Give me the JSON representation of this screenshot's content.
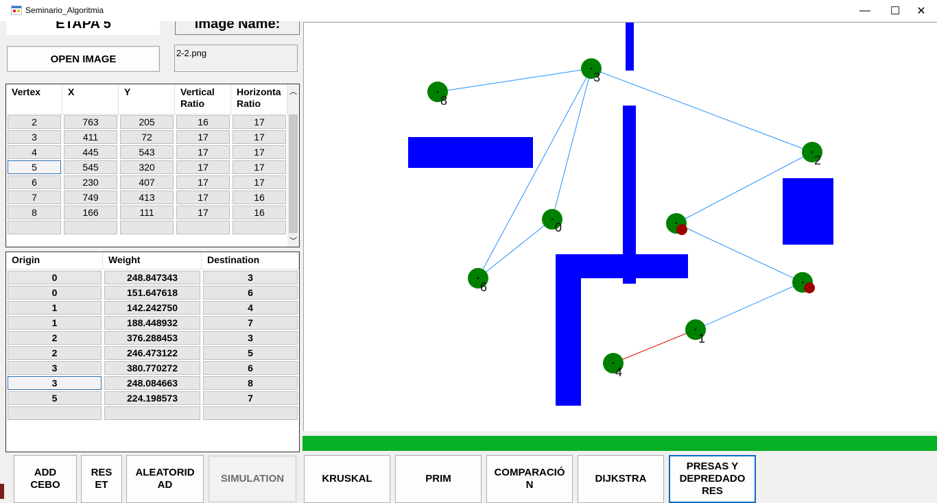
{
  "window": {
    "title": "Seminario_Algoritmia",
    "minimize": "—",
    "maximize": "☐",
    "close": "✕"
  },
  "header": {
    "stage": "ETAPA 5",
    "image_name_label": "Image Name:",
    "open_button": "OPEN IMAGE",
    "file_name": "2-2.png"
  },
  "vertex_table": {
    "columns": [
      "Vertex",
      "X",
      "Y",
      "Vertical\nRatio",
      "Horizonta\nRatio"
    ],
    "rows": [
      [
        "2",
        "763",
        "205",
        "16",
        "17"
      ],
      [
        "3",
        "411",
        "72",
        "17",
        "17"
      ],
      [
        "4",
        "445",
        "543",
        "17",
        "17"
      ],
      [
        "5",
        "545",
        "320",
        "17",
        "17"
      ],
      [
        "6",
        "230",
        "407",
        "17",
        "17"
      ],
      [
        "7",
        "749",
        "413",
        "17",
        "16"
      ],
      [
        "8",
        "166",
        "111",
        "17",
        "16"
      ],
      [
        "",
        "",
        "",
        "",
        ""
      ]
    ]
  },
  "edge_table": {
    "columns": [
      "Origin",
      "Weight",
      "Destination"
    ],
    "rows": [
      [
        "0",
        "248.847343",
        "3"
      ],
      [
        "0",
        "151.647618",
        "6"
      ],
      [
        "1",
        "142.242750",
        "4"
      ],
      [
        "1",
        "188.448932",
        "7"
      ],
      [
        "2",
        "376.288453",
        "3"
      ],
      [
        "2",
        "246.473122",
        "5"
      ],
      [
        "3",
        "380.770272",
        "6"
      ],
      [
        "3",
        "248.084663",
        "8"
      ],
      [
        "5",
        "224.198573",
        "7"
      ],
      [
        "",
        "",
        ""
      ]
    ]
  },
  "graph": {
    "node_color": "#008000",
    "predator_color": "#9b0000",
    "obstacle_color": "#0000ff",
    "edge_color": "#1e90ff",
    "path_color": "#e00000",
    "nodes": [
      {
        "label": "0"
      },
      {
        "label": "1"
      },
      {
        "label": "2"
      },
      {
        "label": "3"
      },
      {
        "label": "4"
      },
      {
        "label": ""
      },
      {
        "label": "6"
      },
      {
        "label": ""
      },
      {
        "label": "8"
      }
    ]
  },
  "progress": {
    "value": 1.0,
    "color": "#06b025"
  },
  "buttons": {
    "add_cebo": "ADD\nCEBO",
    "reset": "RES\nET",
    "aleatoridad": "ALEATORID\nAD",
    "simulation": "SIMULATION",
    "kruskal": "KRUSKAL",
    "prim": "PRIM",
    "comparacion": "COMPARACIÓ\nN",
    "dijkstra": "DIJKSTRA",
    "presas": "PRESAS Y\nDEPREDADO\nRES"
  }
}
